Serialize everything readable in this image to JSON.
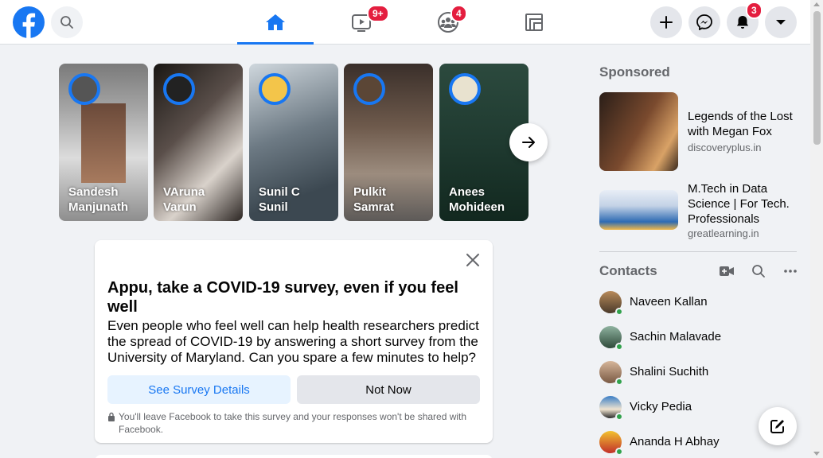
{
  "nav": {
    "video_badge": "9+",
    "groups_badge": "4",
    "notifications_badge": "3"
  },
  "stories": [
    {
      "name": "Sandesh Manjunath"
    },
    {
      "name": "VAruna Varun"
    },
    {
      "name": "Sunil C Sunil"
    },
    {
      "name": "Pulkit Samrat"
    },
    {
      "name": "Anees Mohideen"
    }
  ],
  "survey": {
    "title": "Appu, take a COVID-19 survey, even if you feel well",
    "body": "Even people who feel well can help health researchers predict the spread of COVID-19 by answering a short survey from the University of Maryland. Can you spare a few minutes to help?",
    "primary_label": "See Survey Details",
    "secondary_label": "Not Now",
    "note": "You'll leave Facebook to take this survey and your responses won't be shared with Facebook."
  },
  "sponsored": {
    "title": "Sponsored",
    "ads": [
      {
        "title": "Legends of the Lost with Megan Fox",
        "domain": "discoveryplus.in"
      },
      {
        "title": "M.Tech in Data Science | For Tech. Professionals",
        "domain": "greatlearning.in"
      }
    ]
  },
  "contacts": {
    "title": "Contacts",
    "items": [
      {
        "name": "Naveen Kallan"
      },
      {
        "name": "Sachin Malavade"
      },
      {
        "name": "Shalini Suchith"
      },
      {
        "name": "Vicky Pedia"
      },
      {
        "name": "Ananda H Abhay"
      }
    ]
  },
  "colors": {
    "brand": "#1877f2",
    "badge": "#e41e3f",
    "online": "#31a24c"
  }
}
